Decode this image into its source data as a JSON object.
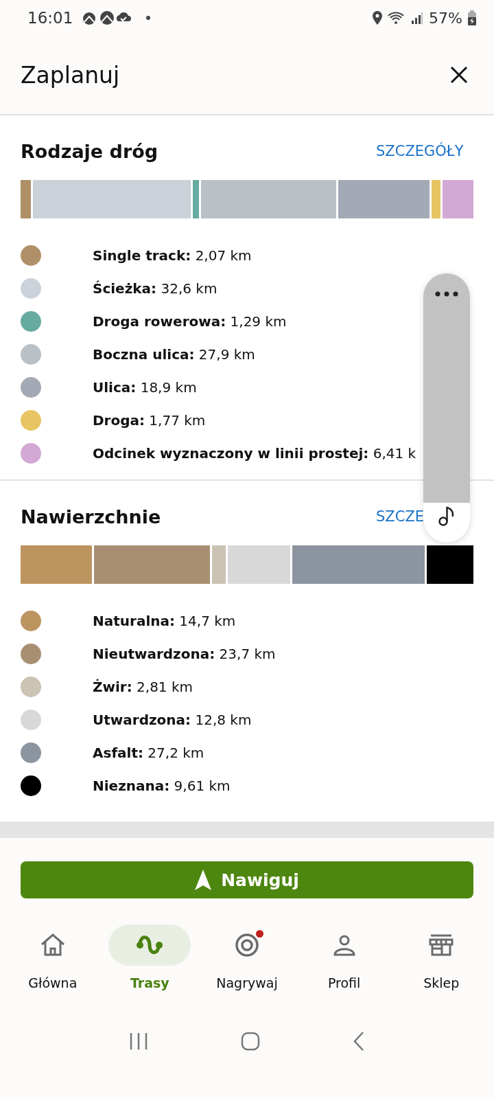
{
  "status_bar": {
    "time": "16:01",
    "battery": "57%"
  },
  "header": {
    "title": "Zaplanuj"
  },
  "sections": [
    {
      "title": "Rodzaje dróg",
      "link": "SZCZEGÓŁY",
      "items": [
        {
          "label": "Single track:",
          "value": "2,07 km",
          "color": "#b09068"
        },
        {
          "label": "Ścieżka:",
          "value": "32,6 km",
          "color": "#ccd2da"
        },
        {
          "label": "Droga rowerowa:",
          "value": "1,29 km",
          "color": "#66aaa0"
        },
        {
          "label": "Boczna ulica:",
          "value": "27,9 km",
          "color": "#b9c0c6"
        },
        {
          "label": "Ulica:",
          "value": "18,9 km",
          "color": "#a3aab5"
        },
        {
          "label": "Droga:",
          "value": "1,77 km",
          "color": "#e8c462"
        },
        {
          "label": "Odcinek wyznaczony w linii prostej:",
          "value": "6,41 k",
          "color": "#d2a8d4"
        }
      ]
    },
    {
      "title": "Nawierzchnie",
      "link": "SZCZE",
      "items": [
        {
          "label": "Naturalna:",
          "value": "14,7 km",
          "color": "#bc9460"
        },
        {
          "label": "Nieutwardzona:",
          "value": "23,7 km",
          "color": "#a98f72"
        },
        {
          "label": "Żwir:",
          "value": "2,81 km",
          "color": "#cbc3b3"
        },
        {
          "label": "Utwardzona:",
          "value": "12,8 km",
          "color": "#d8d8d8"
        },
        {
          "label": "Asfalt:",
          "value": "27,2 km",
          "color": "#8c94a0"
        },
        {
          "label": "Nieznana:",
          "value": "9,61 km",
          "color": "#000000"
        }
      ]
    }
  ],
  "navigate_button": "Nawiguj",
  "nav": [
    {
      "kind": "home",
      "label": "Główna",
      "selected": false,
      "badge": false
    },
    {
      "kind": "routes",
      "label": "Trasy",
      "selected": true,
      "badge": false
    },
    {
      "kind": "record",
      "label": "Nagrywaj",
      "selected": false,
      "badge": true
    },
    {
      "kind": "profile",
      "label": "Profil",
      "selected": false,
      "badge": false
    },
    {
      "kind": "shop",
      "label": "Sklep",
      "selected": false,
      "badge": false
    }
  ]
}
